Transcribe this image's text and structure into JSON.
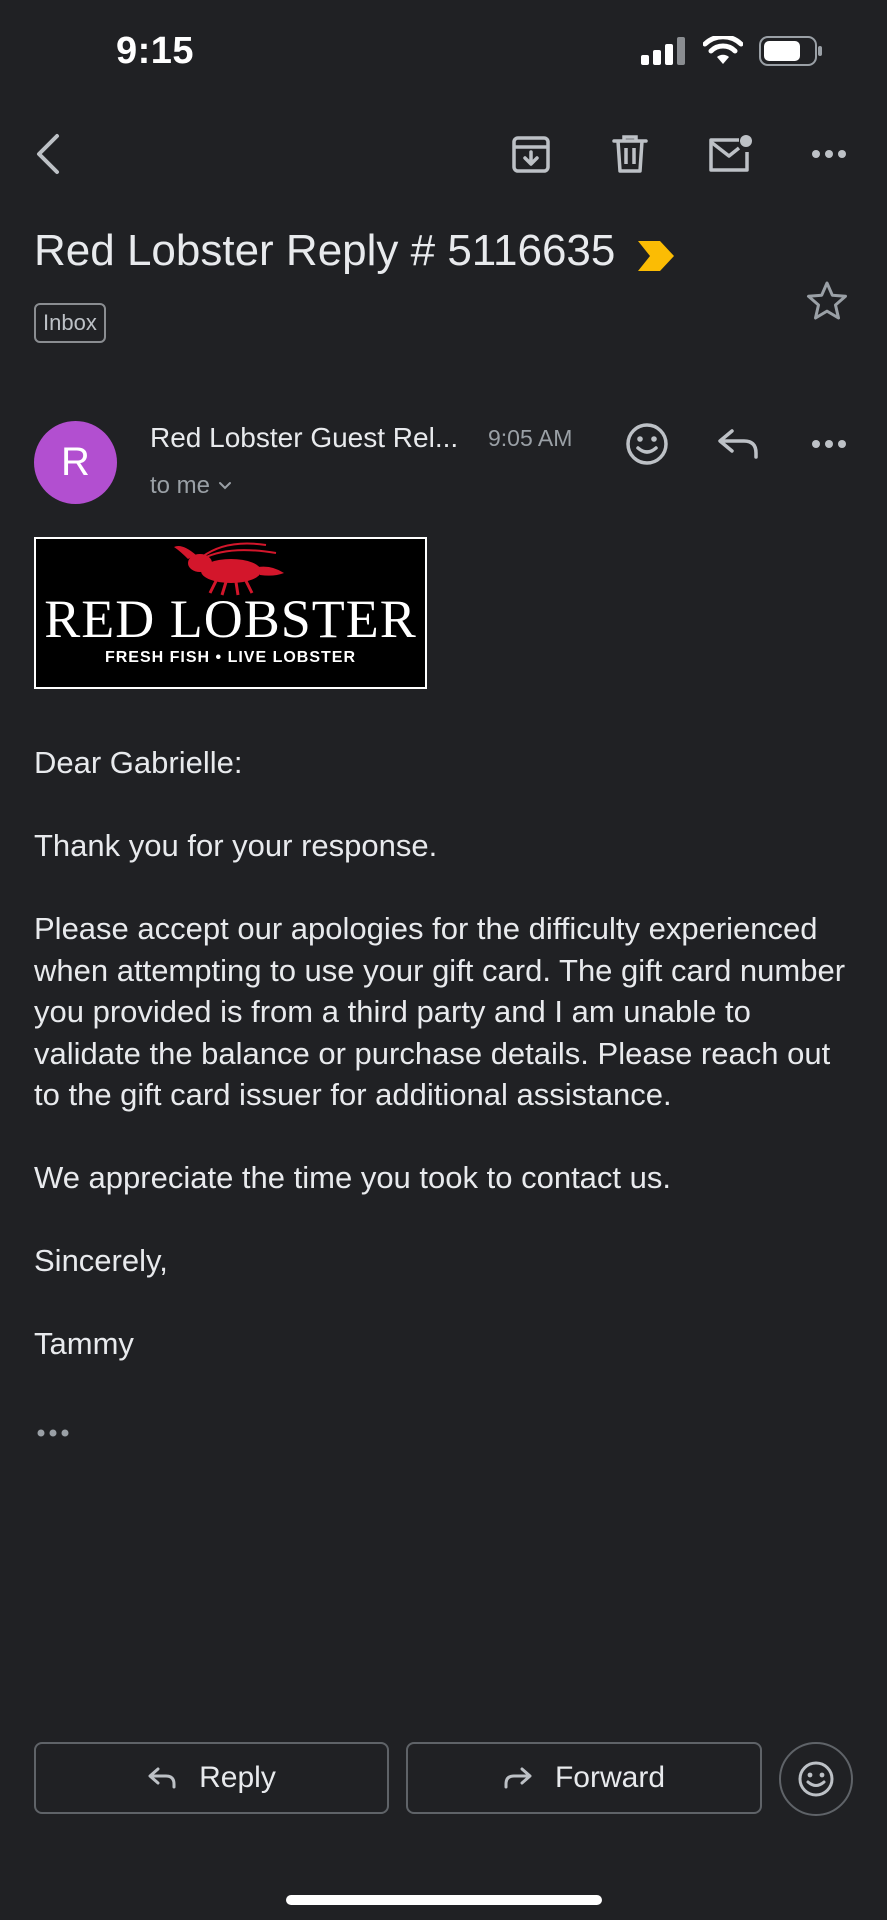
{
  "status_bar": {
    "time": "9:15"
  },
  "toolbar": {
    "icons": [
      "back-arrow-icon",
      "archive-icon",
      "delete-icon",
      "mark-unread-icon",
      "more-options-icon"
    ]
  },
  "email": {
    "subject": "Red Lobster Reply # 5116635",
    "importance_color": "#fbbc04",
    "label": "Inbox",
    "sender": {
      "avatar_letter": "R",
      "avatar_color": "#b24fd0",
      "name": "Red Lobster Guest Rel...",
      "time": "9:05 AM",
      "recipient": "to me"
    },
    "logo": {
      "title": "RED LOBSTER",
      "tagline": "FRESH FISH • LIVE LOBSTER"
    },
    "body": {
      "greeting": "Dear Gabrielle:",
      "p1": "Thank you for your response.",
      "p2": "Please accept our apologies for the difficulty experienced when attempting to use your gift card. The gift card number you provided is from a third party and I am unable to validate the balance or purchase details. Please reach out to the gift card issuer for additional assistance.",
      "p3": "We appreciate the time you took to contact us.",
      "closing": "Sincerely,",
      "signature": "Tammy"
    }
  },
  "actions": {
    "reply_label": "Reply",
    "forward_label": "Forward"
  }
}
